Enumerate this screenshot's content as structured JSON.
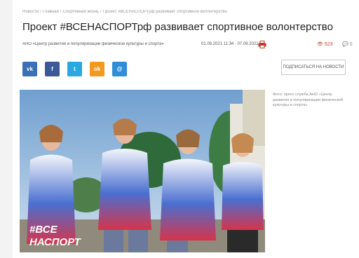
{
  "breadcrumbs": [
    "Новости",
    "Главная",
    "Спортивная жизнь",
    "Проект #ВСЕНАСПОРТрф развивает спортивное волонтерство"
  ],
  "breadcrumb_separator": "/",
  "title": "Проект #ВСЕНАСПОРТрф развивает спортивное волонтерство",
  "meta": {
    "author": "АНО «Центр развития и популяризации физической культуры и спорта»",
    "date": "01.09.2021 11:34 · 07.09.2021",
    "views": "523",
    "comments": "0"
  },
  "share": {
    "vk": "vk",
    "fb": "f",
    "tw": "t",
    "ok": "ok",
    "mm": "@"
  },
  "subscribe_label": "ПОДПИСАТЬСЯ НА НОВОСТИ",
  "photo": {
    "caption": "Фото: пресс-служба АНО «Центр развития и популяризации физической культуры и спорта»",
    "watermark_line1": "#ВСЕ",
    "watermark_line2": "НАСПОРТ"
  },
  "colors": {
    "views": "#c0392b",
    "vk": "#3b6fb6",
    "facebook": "#3b5998",
    "twitter": "#2aa9e0",
    "odnoklassniki": "#f39a1e",
    "mailru": "#2f8ed8"
  }
}
